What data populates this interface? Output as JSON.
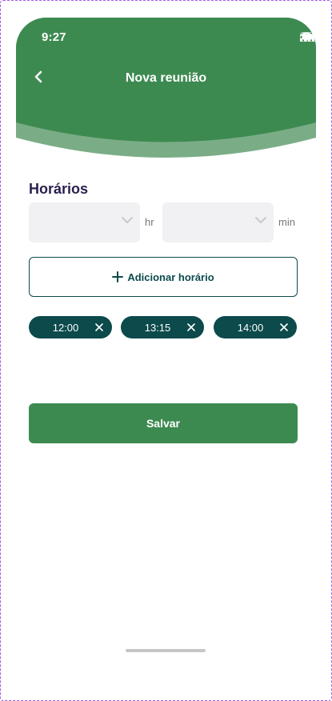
{
  "status_bar": {
    "time": "9:27",
    "icons": [
      "signal-icon",
      "wifi-icon",
      "battery-icon"
    ]
  },
  "header": {
    "title": "Nova reunião",
    "back_icon": "chevron-left-icon",
    "color_primary": "#3d8a51",
    "color_wave": "#7aad86"
  },
  "schedule": {
    "section_title": "Horários",
    "hour_select": {
      "value": "",
      "unit": "hr"
    },
    "minute_select": {
      "value": "",
      "unit": "min"
    },
    "add_label": "Adicionar horário",
    "times": [
      {
        "label": "12:00"
      },
      {
        "label": "13:15"
      },
      {
        "label": "14:00"
      }
    ],
    "chip_color": "#0c4a4c"
  },
  "actions": {
    "save_label": "Salvar"
  }
}
